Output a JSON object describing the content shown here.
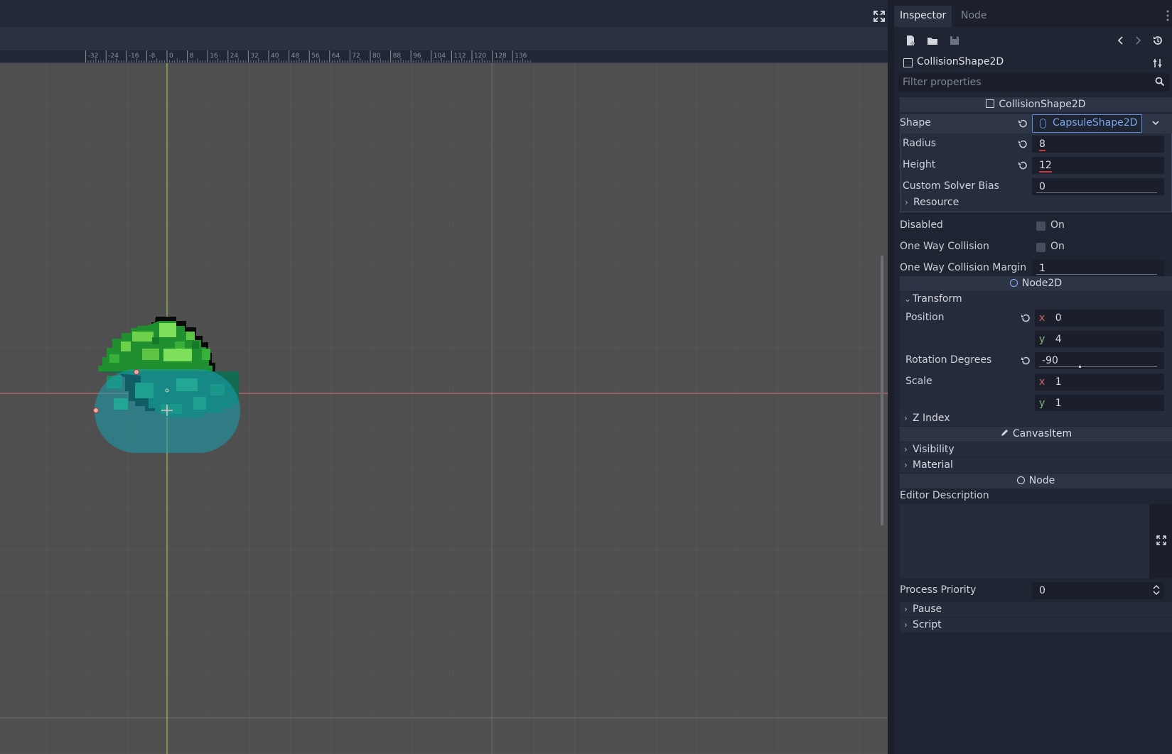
{
  "inspector": {
    "tabs": [
      "Inspector",
      "Node"
    ],
    "object_name": "CollisionShape2D",
    "filter_placeholder": "Filter properties"
  },
  "ruler": {
    "labels": [
      "-32",
      "-24",
      "-16",
      "-8",
      "0",
      "8",
      "16",
      "24",
      "32",
      "40",
      "48",
      "56",
      "64",
      "72",
      "80",
      "88",
      "96",
      "104",
      "112",
      "120",
      "128",
      "136"
    ]
  },
  "sections": {
    "collision_shape": "CollisionShape2D",
    "node2d": "Node2D",
    "canvas_item": "CanvasItem",
    "node": "Node"
  },
  "props": {
    "shape_label": "Shape",
    "shape_value": "CapsuleShape2D",
    "radius_label": "Radius",
    "radius_value": "8",
    "height_label": "Height",
    "height_value": "12",
    "solver_bias_label": "Custom Solver Bias",
    "solver_bias_value": "0",
    "resource_group": "Resource",
    "disabled_label": "Disabled",
    "disabled_value": "On",
    "one_way_label": "One Way Collision",
    "one_way_value": "On",
    "one_way_margin_label": "One Way Collision Margin",
    "one_way_margin_value": "1",
    "transform_group": "Transform",
    "position_label": "Position",
    "position_x": "0",
    "position_y": "4",
    "rotation_label": "Rotation Degrees",
    "rotation_value": "-90",
    "scale_label": "Scale",
    "scale_x": "1",
    "scale_y": "1",
    "z_index_group": "Z Index",
    "visibility_group": "Visibility",
    "material_group": "Material",
    "editor_desc_label": "Editor Description",
    "process_priority_label": "Process Priority",
    "process_priority_value": "0",
    "pause_group": "Pause",
    "script_group": "Script",
    "axis_x": "x",
    "axis_y": "y"
  },
  "colors": {
    "accent": "#5e8de2",
    "sprite_light_green": "#7ed957",
    "sprite_dark_green": "#16933a",
    "collision_overlay": "#1aa0b0"
  }
}
